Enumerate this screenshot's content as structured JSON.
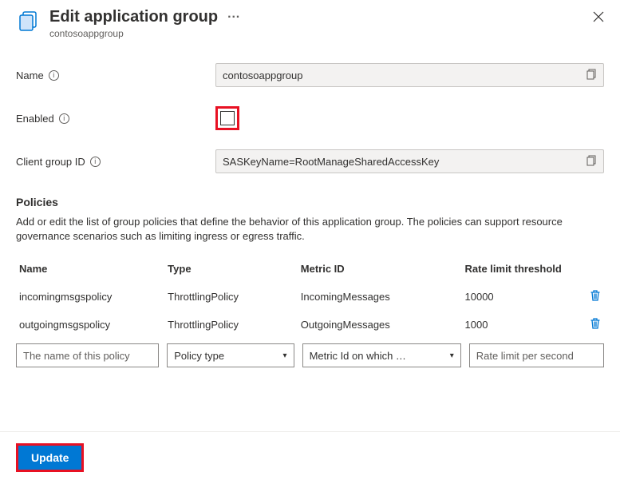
{
  "header": {
    "title": "Edit application group",
    "subtitle": "contosoappgroup"
  },
  "form": {
    "name_label": "Name",
    "name_value": "contosoappgroup",
    "enabled_label": "Enabled",
    "client_group_id_label": "Client group ID",
    "client_group_id_value": "SASKeyName=RootManageSharedAccessKey"
  },
  "policies": {
    "section_title": "Policies",
    "section_desc": "Add or edit the list of group policies that define the behavior of this application group. The policies can support resource governance scenarios such as limiting ingress or egress traffic.",
    "columns": {
      "name": "Name",
      "type": "Type",
      "metric": "Metric ID",
      "rate": "Rate limit threshold"
    },
    "rows": [
      {
        "name": "incomingmsgspolicy",
        "type": "ThrottlingPolicy",
        "metric": "IncomingMessages",
        "rate": "10000"
      },
      {
        "name": "outgoingmsgspolicy",
        "type": "ThrottlingPolicy",
        "metric": "OutgoingMessages",
        "rate": "1000"
      }
    ],
    "new_row": {
      "name_placeholder": "The name of this policy",
      "type_placeholder": "Policy type",
      "metric_placeholder": "Metric Id on which …",
      "rate_placeholder": "Rate limit per second"
    }
  },
  "footer": {
    "update_label": "Update"
  }
}
